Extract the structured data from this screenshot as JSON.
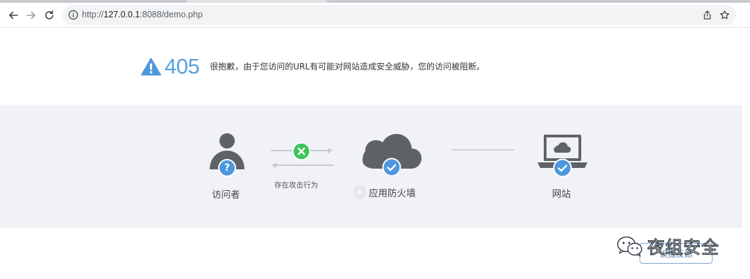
{
  "browser": {
    "url_prefix": "http://",
    "url_host": "127.0.0.1",
    "url_rest": ":8088/demo.php"
  },
  "error": {
    "code": "405",
    "message": "很抱歉，由于您访问的URL有可能对网站造成安全威胁，您的访问被阻断。"
  },
  "flow": {
    "visitor_label": "访问者",
    "action_label": "存在攻击行为",
    "firewall_label": "应用防火墙",
    "website_label": "网站"
  },
  "feedback_label": "误报反馈",
  "watermark_text": "夜组安全",
  "colors": {
    "accent_blue": "#4e97dd",
    "error_code_blue": "#56a0dc",
    "band_bg": "#f1f2f5",
    "green": "#3cc55a",
    "icon_grey": "#5f6368"
  }
}
